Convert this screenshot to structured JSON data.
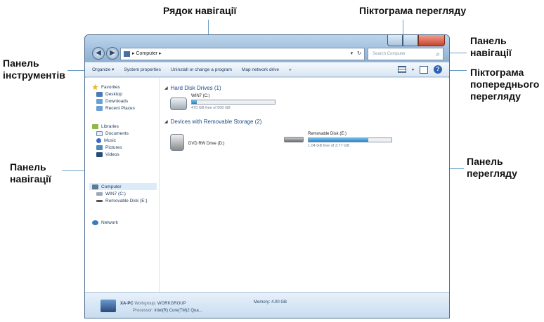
{
  "callouts": {
    "address_bar": "Рядок навігації",
    "view_icon": "Піктограма перегляду",
    "nav_panel_top_line1": "Панель",
    "nav_panel_top_line2": "навігації",
    "preview_icon_line1": "Піктограма",
    "preview_icon_line2": "попереднього",
    "preview_icon_line3": "перегляду",
    "toolbar_line1": "Панель",
    "toolbar_line2": "інструментів",
    "nav_pane_line1": "Панель",
    "nav_pane_line2": "навігації",
    "view_pane_line1": "Панель",
    "view_pane_line2": "перегляду"
  },
  "window": {
    "address": {
      "path": "▸ Computer ▸",
      "refresh": "↻"
    },
    "search_placeholder": "Search Computer",
    "toolbar": {
      "organize": "Organize ▾",
      "system_properties": "System properties",
      "uninstall": "Uninstall or change a program",
      "map_drive": "Map network drive",
      "more": "»",
      "help": "?"
    },
    "nav_pane": {
      "favorites": "Favorites",
      "desktop": "Desktop",
      "downloads": "Downloads",
      "recent": "Recent Places",
      "libraries": "Libraries",
      "documents": "Documents",
      "music": "Music",
      "pictures": "Pictures",
      "videos": "Videos",
      "computer": "Computer",
      "win7": "WIN7 (C:)",
      "removable": "Removable Disk (E:)",
      "network": "Network"
    },
    "main": {
      "hdd_header": "Hard Disk Drives (1)",
      "win7_name": "WIN7 (C:)",
      "win7_free": "470 GB free of 500 GB",
      "win7_used_fraction": 0.06,
      "removable_header": "Devices with Removable Storage (2)",
      "dvd_name": "DVD RW Drive (D:)",
      "usb_name": "Removable Disk (E:)",
      "usb_free": "1.04 GB free of 3.77 GB",
      "usb_used_fraction": 0.72
    },
    "details": {
      "computer_name": "XA-PC",
      "workgroup_label": "Workgroup:",
      "workgroup": "WORKGROUP",
      "memory_label": "Memory:",
      "memory": "4.00 GB",
      "processor_label": "Processor:",
      "processor": "Intel(R) Core(TM)2 Qua..."
    }
  },
  "colors": {
    "callout_line": "#6a9fc8",
    "bar_fill": "#2682c6"
  }
}
